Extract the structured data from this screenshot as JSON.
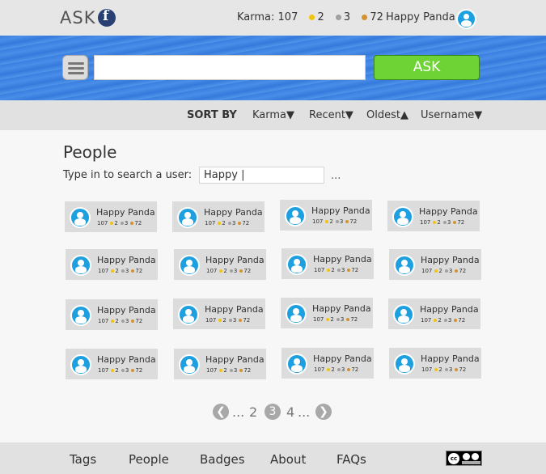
{
  "header": {
    "logo_text": "ASK",
    "karma_label": "Karma: 107",
    "badge_gold": "2",
    "badge_silver": "3",
    "badge_bronze": "72",
    "username": "Happy Panda",
    "colors": {
      "gold": "#f1c40f",
      "silver": "#a0a0a0",
      "bronze": "#d4922f",
      "avatar": "#1e9fe0"
    }
  },
  "search": {
    "value": "",
    "ask_label": "ASK",
    "ask_color": "#6ed334"
  },
  "sort": {
    "label": "SORT BY",
    "options": [
      "Karma▼",
      "Recent▼",
      "Oldest▲",
      "Username▼"
    ]
  },
  "main": {
    "title": "People",
    "search_label": "Type in to search a user:",
    "search_value": "Happy |",
    "more": "..."
  },
  "users": [
    {
      "name": "Happy Panda",
      "karma": "107",
      "gold": "2",
      "silver": "3",
      "bronze": "72"
    },
    {
      "name": "Happy Panda",
      "karma": "107",
      "gold": "2",
      "silver": "3",
      "bronze": "72"
    },
    {
      "name": "Happy Panda",
      "karma": "107",
      "gold": "2",
      "silver": "3",
      "bronze": "72"
    },
    {
      "name": "Happy Panda",
      "karma": "107",
      "gold": "2",
      "silver": "3",
      "bronze": "72"
    },
    {
      "name": "Happy Panda",
      "karma": "107",
      "gold": "2",
      "silver": "3",
      "bronze": "72"
    },
    {
      "name": "Happy Panda",
      "karma": "107",
      "gold": "2",
      "silver": "3",
      "bronze": "72"
    },
    {
      "name": "Happy Panda",
      "karma": "107",
      "gold": "2",
      "silver": "3",
      "bronze": "72"
    },
    {
      "name": "Happy Panda",
      "karma": "107",
      "gold": "2",
      "silver": "3",
      "bronze": "72"
    },
    {
      "name": "Happy Panda",
      "karma": "107",
      "gold": "2",
      "silver": "3",
      "bronze": "72"
    },
    {
      "name": "Happy Panda",
      "karma": "107",
      "gold": "2",
      "silver": "3",
      "bronze": "72"
    },
    {
      "name": "Happy Panda",
      "karma": "107",
      "gold": "2",
      "silver": "3",
      "bronze": "72"
    },
    {
      "name": "Happy Panda",
      "karma": "107",
      "gold": "2",
      "silver": "3",
      "bronze": "72"
    },
    {
      "name": "Happy Panda",
      "karma": "107",
      "gold": "2",
      "silver": "3",
      "bronze": "72"
    },
    {
      "name": "Happy Panda",
      "karma": "107",
      "gold": "2",
      "silver": "3",
      "bronze": "72"
    },
    {
      "name": "Happy Panda",
      "karma": "107",
      "gold": "2",
      "silver": "3",
      "bronze": "72"
    },
    {
      "name": "Happy Panda",
      "karma": "107",
      "gold": "2",
      "silver": "3",
      "bronze": "72"
    }
  ],
  "pagination": {
    "prev_icon": "chevron-left-icon",
    "ellipsis_left": "...",
    "page_prev": "2",
    "page_current": "3",
    "page_next": "4",
    "ellipsis_right": "...",
    "next_icon": "chevron-right-icon"
  },
  "footer": {
    "links": [
      "Tags",
      "People",
      "Badges",
      "About",
      "FAQs"
    ],
    "license_icon": "creative-commons-badge"
  }
}
